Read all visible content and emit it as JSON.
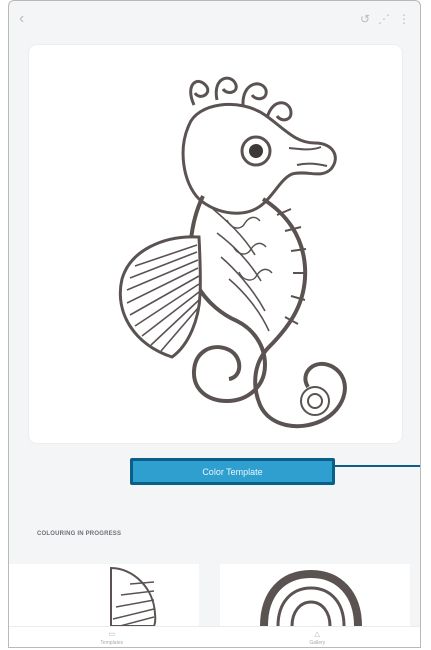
{
  "app": {
    "toolbar": {
      "back_icon": "back-arrow-icon",
      "right_icons": [
        "undo-icon",
        "share-icon",
        "more-vert-icon"
      ]
    },
    "main": {
      "artwork_name": "seahorse coloring page",
      "color_button_label": "Color Template",
      "callout_color": "#0b5e86"
    },
    "section": {
      "title": "COLOURING IN PROGRESS"
    },
    "thumbnails": [
      {
        "name": "seahorse-fin-thumbnail"
      },
      {
        "name": "arch-thumbnail"
      }
    ],
    "bottom_nav": [
      {
        "label": "Templates",
        "icon": "template-icon"
      },
      {
        "label": "Gallery",
        "icon": "gallery-icon"
      }
    ],
    "colors": {
      "accent": "#2f9fd0",
      "border": "#0a5f88",
      "background": "#f4f5f6",
      "card": "#ffffff",
      "linework": "#5b5352"
    }
  }
}
